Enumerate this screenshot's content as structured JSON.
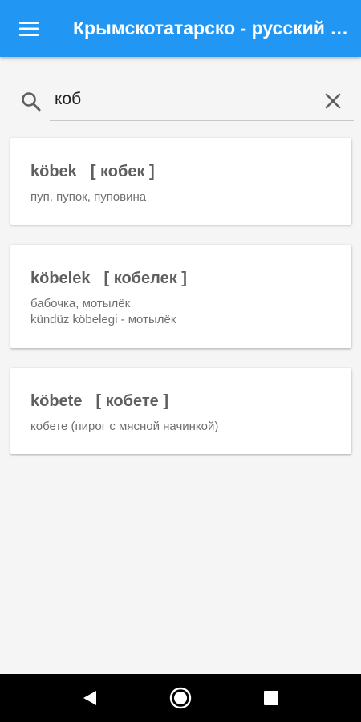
{
  "app": {
    "title": "Крымскотатарско - русский словарь",
    "accent_color": "#2196f3",
    "menu_icon": "menu-icon"
  },
  "search": {
    "query": "коб",
    "search_icon": "search-icon",
    "clear_icon": "close-icon"
  },
  "results": [
    {
      "word": "köbek",
      "transliteration": "[ кобек ]",
      "lines": [
        "пуп, пупок, пуповина"
      ]
    },
    {
      "word": "köbelek",
      "transliteration": "[ кобелек ]",
      "lines": [
        "бабочка, мотылёк",
        "kündüz köbelegi - мотылёк"
      ]
    },
    {
      "word": "köbete",
      "transliteration": "[ кобете ]",
      "lines": [
        "кобете (пирог с мясной начинкой)"
      ]
    }
  ],
  "navigation": {
    "back_icon": "back-icon",
    "home_icon": "home-icon",
    "recents_icon": "recents-icon"
  }
}
